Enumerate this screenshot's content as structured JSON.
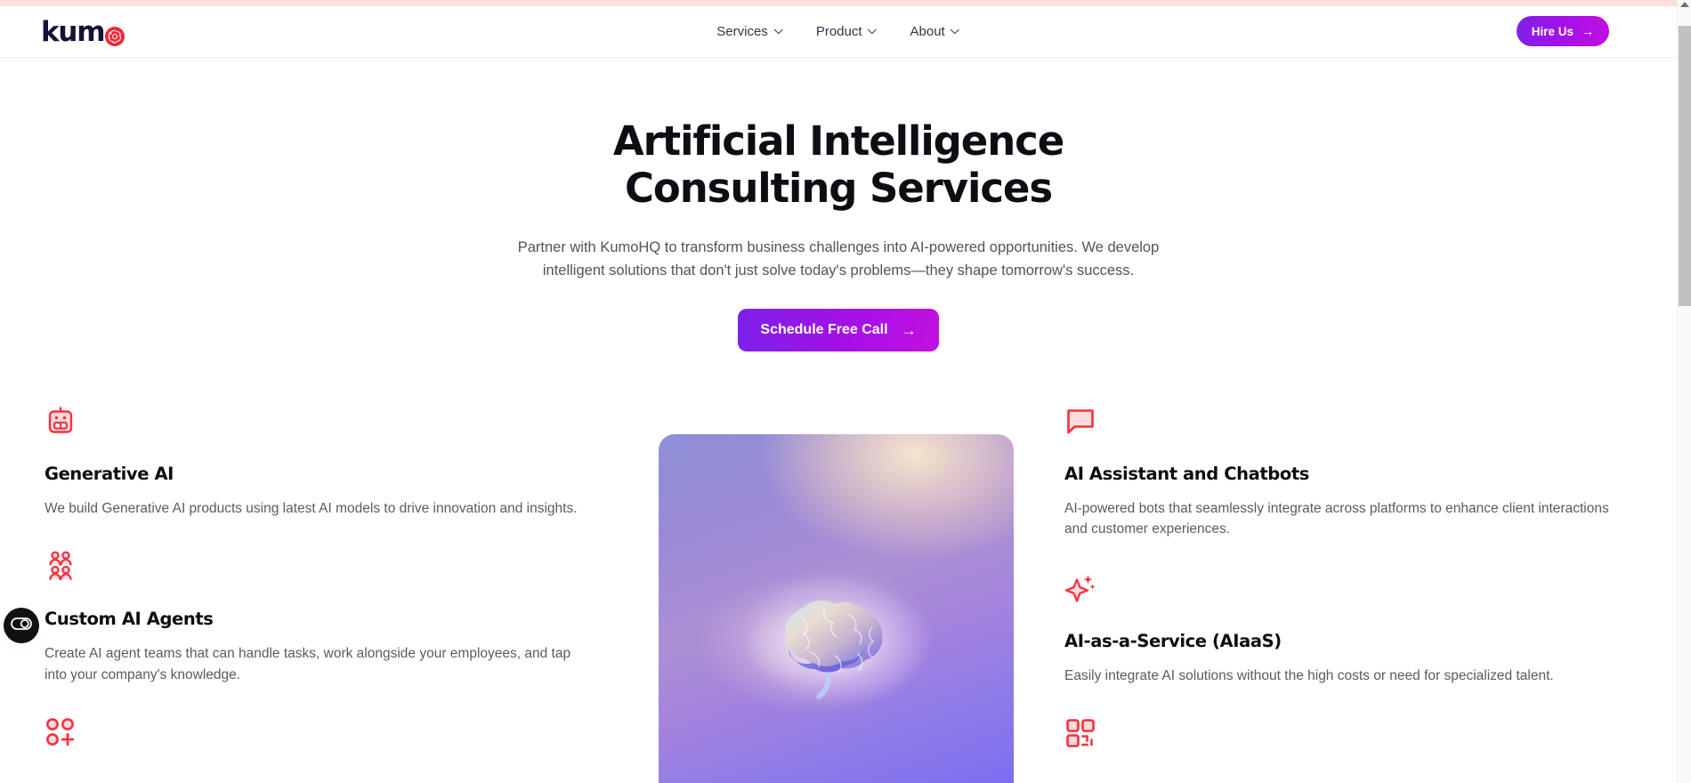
{
  "brand": {
    "logo_word": "kum",
    "logo_mark_name": "kumo-spiral-mark",
    "accent_red": "#f32735",
    "ink": "#191036"
  },
  "header": {
    "nav": [
      {
        "label": "Services",
        "icon": "chevron-down-icon"
      },
      {
        "label": "Product",
        "icon": "chevron-down-icon"
      },
      {
        "label": "About",
        "icon": "chevron-down-icon"
      }
    ],
    "cta": {
      "label": "Hire Us",
      "arrow": "→",
      "gradient_from": "#7b22e8",
      "gradient_to": "#c210e0"
    }
  },
  "hero": {
    "title": "Artificial Intelligence Consulting Services",
    "subtitle": "Partner with KumoHQ to transform business challenges into AI-powered opportunities. We develop intelligent solutions that don't just solve today's problems—they shape tomorrow's success.",
    "cta": {
      "label": "Schedule Free Call",
      "arrow": "→"
    },
    "image_alt": "glowing-brain-illustration"
  },
  "features": {
    "left": [
      {
        "icon": "robot-icon",
        "title": "Generative AI",
        "desc": "We build Generative AI products using latest AI models to drive innovation and insights."
      },
      {
        "icon": "users-group-icon",
        "title": "Custom AI Agents",
        "desc": "Create AI agent teams that can handle tasks, work alongside your employees, and tap into your company's knowledge."
      },
      {
        "icon": "circles-plus-icon",
        "title": "",
        "desc": ""
      }
    ],
    "right": [
      {
        "icon": "chat-bubble-icon",
        "title": "AI Assistant and Chatbots",
        "desc": "AI-powered bots that seamlessly integrate across platforms to enhance client interactions and customer experiences."
      },
      {
        "icon": "sparkle-icon",
        "title": "AI-as-a-Service (AIaaS)",
        "desc": "Easily integrate AI solutions without the high costs or need for specialized talent."
      },
      {
        "icon": "qr-code-icon",
        "title": "",
        "desc": ""
      }
    ]
  },
  "cookie_widget": {
    "icon": "cookiebot-toggle-icon"
  },
  "scrollbar": {
    "icon_up": "scroll-up-arrow-icon"
  }
}
